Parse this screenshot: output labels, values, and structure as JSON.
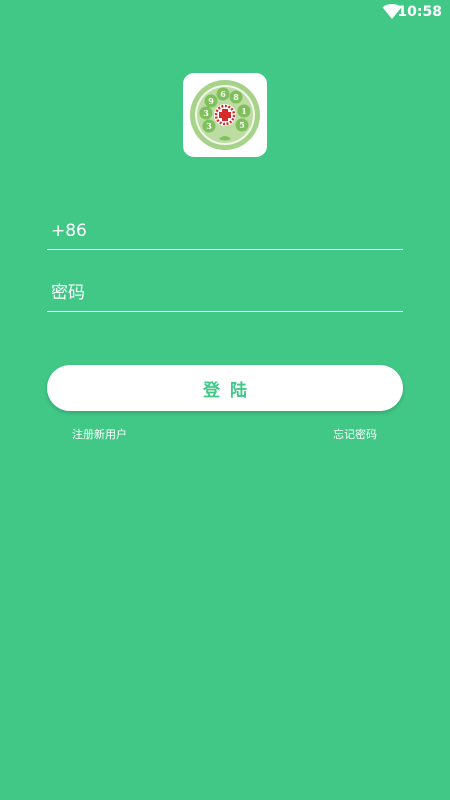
{
  "status_bar": {
    "time": "10:58",
    "wifi_icon": "wifi-icon"
  },
  "logo": {
    "icon": "rotary-dial-logo-icon",
    "digits": [
      "9",
      "6",
      "8",
      "1",
      "5",
      "3",
      "3"
    ]
  },
  "login_form": {
    "phone_value": "+86",
    "password_placeholder": "密码",
    "login_label": "登陆"
  },
  "links": {
    "register": "注册新用户",
    "forgot_password": "忘记密码"
  },
  "colors": {
    "background": "#41c887",
    "logo_green_outer": "#a7d28a",
    "logo_green_inner": "#7fbf5c",
    "logo_red": "#d52b2b"
  }
}
